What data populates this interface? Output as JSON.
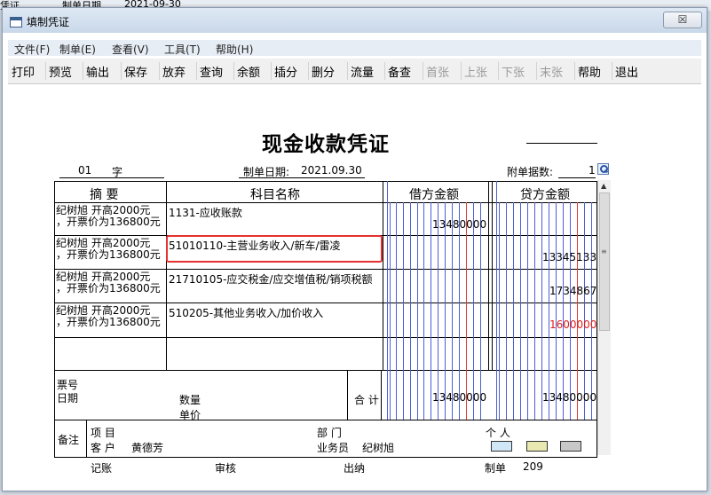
{
  "background": {
    "left_fragment": "凭证",
    "mid_fragment": "制单日期",
    "date_fragment": "2021-09-30"
  },
  "window": {
    "title": "填制凭证",
    "close_glyph": "☒"
  },
  "menu": [
    "文件(F)",
    "制单(E)",
    "查看(V)",
    "工具(T)",
    "帮助(H)"
  ],
  "toolbar": {
    "buttons": [
      {
        "label": "打印",
        "enabled": true
      },
      {
        "label": "预览",
        "enabled": true
      },
      {
        "label": "输出",
        "enabled": true
      },
      {
        "label": "保存",
        "enabled": true
      },
      {
        "label": "放弃",
        "enabled": true
      },
      {
        "label": "查询",
        "enabled": true
      },
      {
        "label": "余额",
        "enabled": true
      },
      {
        "label": "插分",
        "enabled": true
      },
      {
        "label": "删分",
        "enabled": true
      },
      {
        "label": "流量",
        "enabled": true
      },
      {
        "label": "备查",
        "enabled": true
      },
      {
        "label": "首张",
        "enabled": false
      },
      {
        "label": "上张",
        "enabled": false
      },
      {
        "label": "下张",
        "enabled": false
      },
      {
        "label": "末张",
        "enabled": false
      },
      {
        "label": "帮助",
        "enabled": true
      },
      {
        "label": "退出",
        "enabled": true
      }
    ]
  },
  "voucher": {
    "title": "现金收款凭证",
    "voucher_type": "01",
    "voucher_type_label": "字",
    "date_label": "制单日期:",
    "date": "2021.09.30",
    "attach_label": "附单据数:",
    "attach_count": "1",
    "headers": {
      "summary": "摘 要",
      "account": "科目名称",
      "debit": "借方金额",
      "credit": "贷方金额"
    },
    "rows": [
      {
        "summary_1": "纪树旭 开高2000元",
        "summary_2": "，开票价为136800元",
        "account": "1131-应收账款",
        "debit": "13480000",
        "credit": ""
      },
      {
        "summary_1": "纪树旭 开高2000元",
        "summary_2": "，开票价为136800元",
        "account": "51010110-主营业务收入/新车/雷凌",
        "debit": "",
        "credit": "13345133"
      },
      {
        "summary_1": "纪树旭 开高2000元",
        "summary_2": "，开票价为136800元",
        "account": "21710105-应交税金/应交增值税/销项税额",
        "debit": "",
        "credit": "1734867"
      },
      {
        "summary_1": "纪树旭 开高2000元",
        "summary_2": "，开票价为136800元",
        "account": "510205-其他业务收入/加价收入",
        "debit": "",
        "credit": "1600000"
      }
    ],
    "footer": {
      "ticket_label": "票号",
      "date_label": "日期",
      "qty_label": "数量",
      "price_label": "单价",
      "total_label": "合 计",
      "total_debit": "13480000",
      "total_credit": "13480000",
      "remark_label": "备注",
      "project_label": "项 目",
      "dept_label": "部 门",
      "person_label": "个 人",
      "client_label": "客 户",
      "client_name": "黄德芳",
      "clerk_label": "业务员",
      "clerk_name": "纪树旭"
    },
    "signatures": {
      "bookkeeper": "记账",
      "auditor": "审核",
      "cashier": "出纳",
      "maker_label": "制单",
      "maker": "209"
    },
    "colors": {
      "negative_red": "#e31b1b",
      "highlight": "#e5312f",
      "blue_line": "#4d5fd6"
    }
  }
}
